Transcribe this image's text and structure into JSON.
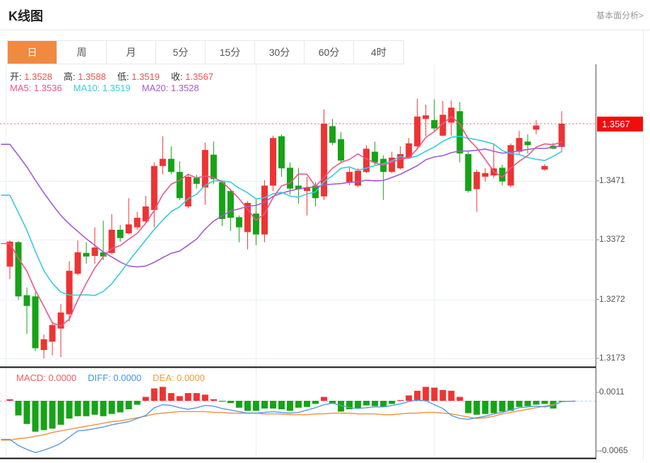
{
  "header": {
    "title": "K线图",
    "link": "基本面分析>"
  },
  "tabs": {
    "items": [
      "日",
      "周",
      "月",
      "5分",
      "15分",
      "30分",
      "60分",
      "4时"
    ],
    "active_index": 0
  },
  "legend": {
    "ohlc": [
      {
        "key": "open",
        "label": "开:",
        "value": "1.3528"
      },
      {
        "key": "high",
        "label": "高:",
        "value": "1.3588"
      },
      {
        "key": "low",
        "label": "低:",
        "value": "1.3519"
      },
      {
        "key": "close",
        "label": "收:",
        "value": "1.3567"
      }
    ],
    "ma": [
      {
        "key": "ma5",
        "label": "MA5:",
        "value": "1.3536",
        "color": "#ee5588"
      },
      {
        "key": "ma10",
        "label": "MA10:",
        "value": "1.3519",
        "color": "#35ccdf"
      },
      {
        "key": "ma20",
        "label": "MA20:",
        "value": "1.3528",
        "color": "#a55bd0"
      }
    ],
    "macd": [
      {
        "key": "macd",
        "label": "MACD:",
        "value": "0.0000",
        "color": "#f25b5b"
      },
      {
        "key": "diff",
        "label": "DIFF:",
        "value": "0.0000",
        "color": "#3f96f2"
      },
      {
        "key": "dea",
        "label": "DEA:",
        "value": "0.0000",
        "color": "#f59a3b"
      }
    ]
  },
  "price_axis": {
    "current": "1.3567",
    "ticks": [
      "1.3471",
      "1.3372",
      "1.3272",
      "1.3173"
    ]
  },
  "macd_axis": {
    "ticks": [
      "0.0011",
      "-0.0065"
    ]
  },
  "colors": {
    "accent_tab": "#f08a40",
    "up": "#ee3333",
    "down": "#16a316",
    "value_red": "#f25050",
    "ma5": "#ee5588",
    "ma10": "#35ccdf",
    "ma20": "#a55bd0",
    "diff": "#5b9bdd",
    "dea": "#f0923f",
    "badge": "#f20d0d",
    "dotted_line": "#f56060",
    "grid": "#e9eef4",
    "zero_dash": "#a5cdee",
    "axis_line": "#555555",
    "divider": "#111111"
  },
  "chart_data": [
    {
      "type": "candlestick",
      "y_ticks": [
        1.3567,
        1.3471,
        1.3372,
        1.3272,
        1.3173
      ],
      "current_price": 1.3567,
      "ylim": [
        1.3156,
        1.3668
      ],
      "grid": true,
      "ma_windows": [
        5,
        10,
        20
      ],
      "ma_prefix_closes": [
        1.365,
        1.3645,
        1.3638,
        1.363,
        1.3622,
        1.3615,
        1.3608,
        1.36,
        1.359,
        1.358,
        1.3568,
        1.3556,
        1.3544,
        1.3532,
        1.344,
        1.34,
        1.337,
        1.335,
        1.334
      ],
      "ohlc": [
        [
          1.3327,
          1.3371,
          1.3306,
          1.3369
        ],
        [
          1.3368,
          1.337,
          1.3271,
          1.3277
        ],
        [
          1.3279,
          1.3292,
          1.3214,
          1.3261
        ],
        [
          1.3277,
          1.3285,
          1.3185,
          1.319
        ],
        [
          1.3187,
          1.3213,
          1.3173,
          1.3205
        ],
        [
          1.3201,
          1.3235,
          1.3178,
          1.3229
        ],
        [
          1.3223,
          1.3264,
          1.3175,
          1.325
        ],
        [
          1.3247,
          1.3336,
          1.3235,
          1.332
        ],
        [
          1.3315,
          1.3371,
          1.3312,
          1.3351
        ],
        [
          1.335,
          1.3368,
          1.3332,
          1.3344
        ],
        [
          1.3345,
          1.3393,
          1.3332,
          1.3359
        ],
        [
          1.3351,
          1.3404,
          1.3338,
          1.3344
        ],
        [
          1.335,
          1.3415,
          1.3347,
          1.3389
        ],
        [
          1.3389,
          1.3397,
          1.3369,
          1.3375
        ],
        [
          1.3383,
          1.3442,
          1.3381,
          1.3398
        ],
        [
          1.3393,
          1.3419,
          1.3389,
          1.3409
        ],
        [
          1.3403,
          1.3446,
          1.3401,
          1.3428
        ],
        [
          1.3422,
          1.3502,
          1.3393,
          1.3496
        ],
        [
          1.3496,
          1.3546,
          1.3482,
          1.3508
        ],
        [
          1.3508,
          1.3529,
          1.3482,
          1.3486
        ],
        [
          1.3486,
          1.3504,
          1.3439,
          1.3442
        ],
        [
          1.3428,
          1.3482,
          1.3425,
          1.3478
        ],
        [
          1.3476,
          1.3481,
          1.3458,
          1.3466
        ],
        [
          1.346,
          1.3535,
          1.3431,
          1.3523
        ],
        [
          1.3515,
          1.3537,
          1.3466,
          1.3474
        ],
        [
          1.3469,
          1.3472,
          1.3395,
          1.3407
        ],
        [
          1.3454,
          1.3457,
          1.3387,
          1.3409
        ],
        [
          1.341,
          1.3413,
          1.3368,
          1.3393
        ],
        [
          1.3385,
          1.3437,
          1.3356,
          1.3434
        ],
        [
          1.3416,
          1.344,
          1.3363,
          1.3381
        ],
        [
          1.3381,
          1.3472,
          1.3368,
          1.3463
        ],
        [
          1.3463,
          1.3547,
          1.3454,
          1.3543
        ],
        [
          1.3546,
          1.3549,
          1.3478,
          1.3492
        ],
        [
          1.3493,
          1.3502,
          1.3448,
          1.3458
        ],
        [
          1.3463,
          1.3493,
          1.3433,
          1.3457
        ],
        [
          1.3454,
          1.3478,
          1.3413,
          1.346
        ],
        [
          1.3463,
          1.3469,
          1.3428,
          1.3442
        ],
        [
          1.3445,
          1.3591,
          1.3439,
          1.3567
        ],
        [
          1.3563,
          1.3575,
          1.3531,
          1.3535
        ],
        [
          1.3541,
          1.3553,
          1.3502,
          1.3505
        ],
        [
          1.3469,
          1.3493,
          1.3464,
          1.3486
        ],
        [
          1.3463,
          1.3492,
          1.346,
          1.3488
        ],
        [
          1.3486,
          1.3531,
          1.3484,
          1.3525
        ],
        [
          1.352,
          1.3537,
          1.3498,
          1.3502
        ],
        [
          1.3508,
          1.3514,
          1.3439,
          1.3486
        ],
        [
          1.3486,
          1.352,
          1.3484,
          1.351
        ],
        [
          1.3492,
          1.3529,
          1.349,
          1.3516
        ],
        [
          1.351,
          1.3543,
          1.3508,
          1.3534
        ],
        [
          1.3529,
          1.3609,
          1.3526,
          1.3579
        ],
        [
          1.3575,
          1.3599,
          1.3546,
          1.3581
        ],
        [
          1.3573,
          1.3608,
          1.3553,
          1.3559
        ],
        [
          1.3547,
          1.3605,
          1.3546,
          1.3582
        ],
        [
          1.3569,
          1.3606,
          1.3547,
          1.3594
        ],
        [
          1.3588,
          1.3603,
          1.3502,
          1.3517
        ],
        [
          1.3516,
          1.352,
          1.3451,
          1.3454
        ],
        [
          1.3457,
          1.349,
          1.3419,
          1.3486
        ],
        [
          1.3478,
          1.3492,
          1.347,
          1.3484
        ],
        [
          1.348,
          1.3534,
          1.3476,
          1.3492
        ],
        [
          1.3493,
          1.3498,
          1.3463,
          1.347
        ],
        [
          1.3463,
          1.3534,
          1.346,
          1.3531
        ],
        [
          1.352,
          1.3555,
          1.3514,
          1.3543
        ],
        [
          1.3537,
          1.3549,
          1.3517,
          1.3531
        ],
        [
          1.3557,
          1.3573,
          1.3549,
          1.3564
        ],
        [
          1.349,
          1.3499,
          1.3488,
          1.3496
        ],
        [
          1.353,
          1.3535,
          1.3524,
          1.3525
        ],
        [
          1.3528,
          1.3588,
          1.3519,
          1.3567
        ]
      ]
    },
    {
      "type": "bar",
      "name": "MACD",
      "y_ticks": [
        0.0011,
        -0.0065
      ],
      "ylim": [
        -0.0074,
        0.0021
      ],
      "hist": [
        0.0002,
        -0.0019,
        -0.003,
        -0.004,
        -0.0038,
        -0.0036,
        -0.0031,
        -0.0023,
        -0.002,
        -0.002,
        -0.0018,
        -0.002,
        -0.0017,
        -0.0015,
        -0.0011,
        -0.0005,
        0.0005,
        0.0016,
        0.0018,
        0.001,
        0.0006,
        0.001,
        0.001,
        0.0008,
        0.0002,
        -0.0001,
        -0.0003,
        -0.0009,
        -0.0013,
        -0.0013,
        -0.001,
        -0.001,
        -0.0011,
        -0.0013,
        -0.0009,
        -0.0008,
        -0.0004,
        0.0005,
        -0.0004,
        -0.0014,
        -0.0011,
        -0.001,
        -0.0006,
        -0.0007,
        -0.0008,
        -0.0004,
        0.0001,
        0.0007,
        0.0013,
        0.0018,
        0.0017,
        0.0014,
        0.0013,
        0.0005,
        -0.0016,
        -0.0018,
        -0.0017,
        -0.0016,
        -0.0014,
        -0.0013,
        -0.0008,
        -0.0007,
        -0.0005,
        -0.0004,
        -0.001,
        -0.0001
      ],
      "diff": [
        -0.005,
        -0.0058,
        -0.0063,
        -0.0067,
        -0.0064,
        -0.006,
        -0.0055,
        -0.0047,
        -0.0039,
        -0.0038,
        -0.0036,
        -0.0034,
        -0.0031,
        -0.0029,
        -0.0027,
        -0.0023,
        -0.0019,
        -0.0009,
        -0.0005,
        -0.0006,
        -0.0009,
        -0.0011,
        -0.0009,
        -0.0006,
        -0.0007,
        -0.001,
        -0.0012,
        -0.0014,
        -0.0016,
        -0.0016,
        -0.0015,
        -0.0014,
        -0.0015,
        -0.0016,
        -0.0015,
        -0.0012,
        -0.0009,
        -0.0005,
        -0.0003,
        -0.0006,
        -0.0009,
        -0.001,
        -0.0009,
        -0.0008,
        -0.0008,
        -0.0006,
        -0.0004,
        -0.0001,
        0.0001,
        0.0,
        -0.0005,
        -0.001,
        -0.0019,
        -0.0023,
        -0.0024,
        -0.0022,
        -0.002,
        -0.0017,
        -0.0015,
        -0.0012,
        -0.0009,
        -0.0008,
        -0.0007,
        -0.0008,
        -0.0006,
        -0.0001
      ],
      "dea": [
        -0.0051,
        -0.0049,
        -0.0048,
        -0.0046,
        -0.0044,
        -0.0041,
        -0.0039,
        -0.0037,
        -0.0035,
        -0.0033,
        -0.0031,
        -0.0029,
        -0.0027,
        -0.0026,
        -0.0024,
        -0.0022,
        -0.002,
        -0.0017,
        -0.0016,
        -0.0015,
        -0.0014,
        -0.0014,
        -0.0014,
        -0.0014,
        -0.0015,
        -0.0015,
        -0.0016,
        -0.0016,
        -0.0016,
        -0.0016,
        -0.0017,
        -0.0017,
        -0.0017,
        -0.0018,
        -0.0018,
        -0.0018,
        -0.0017,
        -0.0017,
        -0.0016,
        -0.0016,
        -0.0016,
        -0.0017,
        -0.0017,
        -0.0017,
        -0.0018,
        -0.0018,
        -0.0017,
        -0.0016,
        -0.0016,
        -0.0015,
        -0.0015,
        -0.0016,
        -0.0017,
        -0.0019,
        -0.0021,
        -0.0023,
        -0.0022,
        -0.002,
        -0.0017,
        -0.0015,
        -0.0013,
        -0.0011,
        -0.0009,
        -0.0007,
        -0.0005,
        -0.0001
      ]
    }
  ]
}
